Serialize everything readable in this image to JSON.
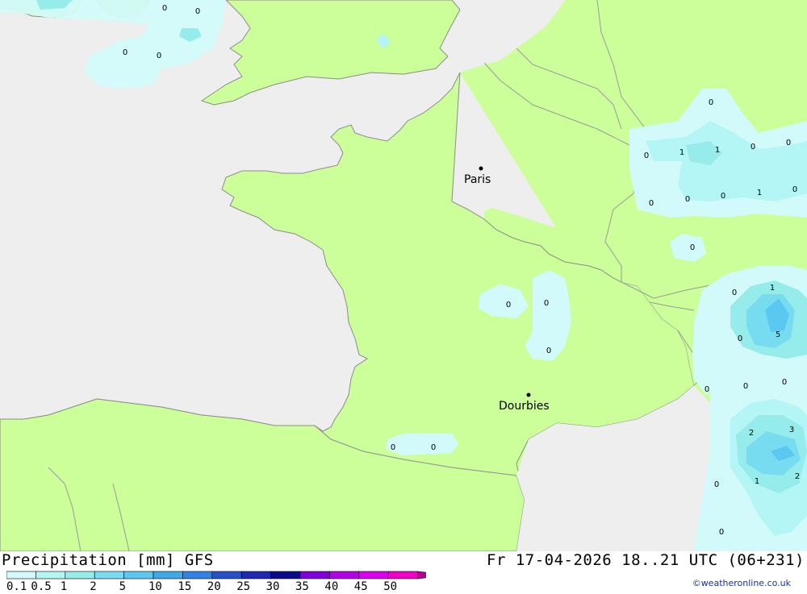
{
  "header": {
    "title": "Precipitation [mm] GFS",
    "datetime": "Fr 17-04-2026 18..21 UTC (06+231)",
    "credit": "©weatheronline.co.uk"
  },
  "cities": [
    {
      "name": "Paris"
    },
    {
      "name": "Dourbies"
    }
  ],
  "values": [
    "0",
    "0",
    "0",
    "0",
    "0",
    "0",
    "1",
    "1",
    "0",
    "0",
    "0",
    "0",
    "0",
    "1",
    "0",
    "0",
    "0",
    "0",
    "0",
    "1",
    "5",
    "0",
    "0",
    "0",
    "0",
    "0",
    "2",
    "3",
    "0",
    "1",
    "2",
    "0",
    "0",
    "0"
  ],
  "legend": {
    "labels": [
      "0.1",
      "0.5",
      "1",
      "2",
      "5",
      "10",
      "15",
      "20",
      "25",
      "30",
      "35",
      "40",
      "45",
      "50"
    ],
    "colors": [
      "#d2fafa",
      "#b4f5f5",
      "#96ebeb",
      "#78dcf0",
      "#5ac8f0",
      "#3caae6",
      "#3282e6",
      "#2850c8",
      "#1e28b4",
      "#0a0a8c",
      "#8200dc",
      "#b400e6",
      "#dc00f0",
      "#f000c8",
      "#b4008c"
    ]
  },
  "colors": {
    "land": "#ccff99",
    "sea": "#eeeeee",
    "border": "#9a9a9a",
    "coast": "#8c8c8c"
  }
}
